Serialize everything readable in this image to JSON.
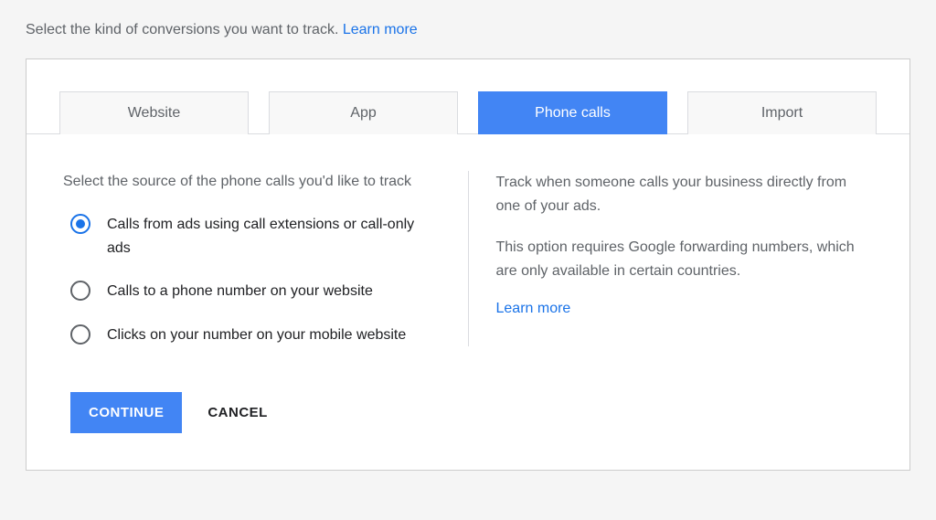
{
  "header": {
    "text": "Select the kind of conversions you want to track.",
    "link": "Learn more"
  },
  "tabs": {
    "items": [
      {
        "label": "Website"
      },
      {
        "label": "App"
      },
      {
        "label": "Phone calls"
      },
      {
        "label": "Import"
      }
    ]
  },
  "phone_calls": {
    "heading": "Select the source of the phone calls you'd like to track",
    "options": [
      {
        "label": "Calls from ads using call extensions or call-only ads"
      },
      {
        "label": "Calls to a phone number on your website"
      },
      {
        "label": "Clicks on your number on your mobile website"
      }
    ],
    "description": {
      "line1": "Track when someone calls your business directly from one of your ads.",
      "line2": "This option requires Google forwarding numbers, which are only available in certain countries.",
      "learn_more": "Learn more"
    }
  },
  "buttons": {
    "continue": "CONTINUE",
    "cancel": "CANCEL"
  }
}
